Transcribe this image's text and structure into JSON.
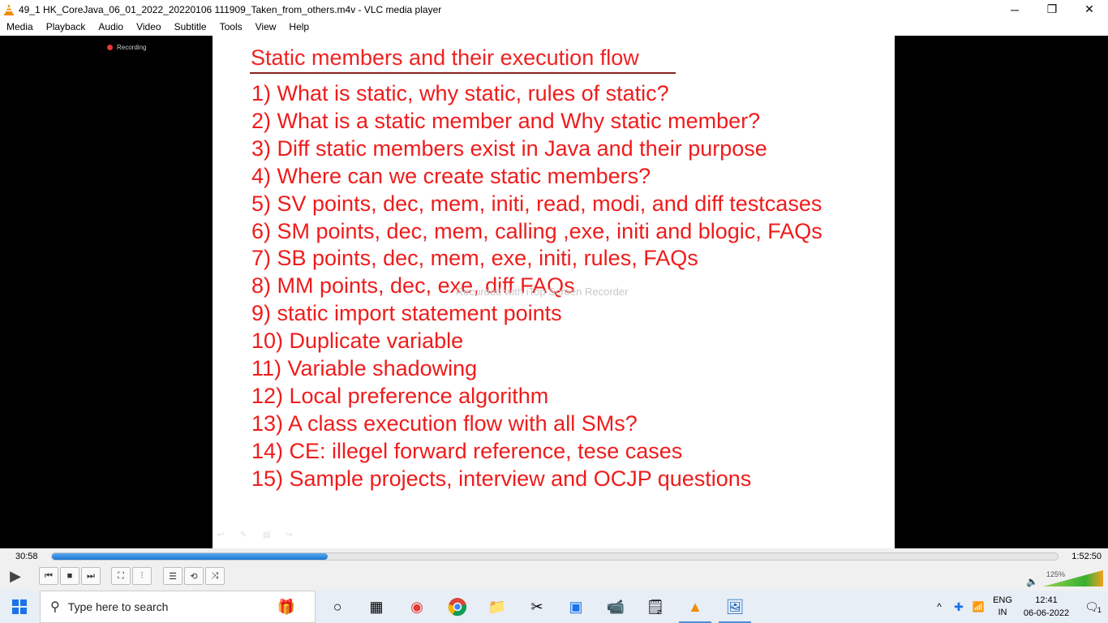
{
  "window": {
    "title": "49_1 HK_CoreJava_06_01_2022_20220106 111909_Taken_from_others.m4v - VLC media player",
    "minimize_glyph": "─",
    "maximize_glyph": "❐",
    "close_glyph": "✕"
  },
  "menu": [
    "Media",
    "Playback",
    "Audio",
    "Video",
    "Subtitle",
    "Tools",
    "View",
    "Help"
  ],
  "video": {
    "recording_label": "Recording",
    "slide_title": "Static members and their execution flow",
    "items": [
      "1) What is static, why static, rules of static?",
      "2) What is a static member and Why static member?",
      "3) Diff static members exist in Java and their purpose",
      "4) Where can we create static members?",
      "5) SV points, dec, mem, initi, read, modi, and diff testcases",
      "6) SM points, dec, mem, calling ,exe, initi and blogic, FAQs",
      "7) SB points, dec, mem, exe, initi, rules, FAQs",
      "8) MM points, dec, exe, diff FAQs",
      "9) static import statement points",
      "10) Duplicate variable",
      "11) Variable shadowing",
      "12) Local preference algorithm",
      "13) A class execution flow with all SMs?",
      "14) CE: illegel forward reference, tese cases",
      "15) Sample projects, interview and OCJP questions"
    ],
    "watermark": "Recorded with iTop Screen Recorder"
  },
  "player": {
    "time_current": "30:58",
    "time_total": "1:52:50",
    "progress": 0.2745,
    "volume_label": "125%",
    "volume_level": 1.0,
    "buttons": {
      "play": "▶",
      "prev": "⏮",
      "stop": "■",
      "next": "⏭",
      "fullscreen": "⛶",
      "extended": "⫶",
      "playlist": "☰",
      "loop": "⟲",
      "shuffle": "⤨"
    }
  },
  "taskbar": {
    "search_placeholder": "Type here to search",
    "lang_line1": "ENG",
    "lang_line2": "IN",
    "time": "12:41",
    "date": "06-06-2022",
    "notification_count": "1"
  },
  "colors": {
    "slide_text": "#ee1c1c",
    "seek_fill": "#1976d2",
    "taskbar_bg": "#e8eef6"
  }
}
